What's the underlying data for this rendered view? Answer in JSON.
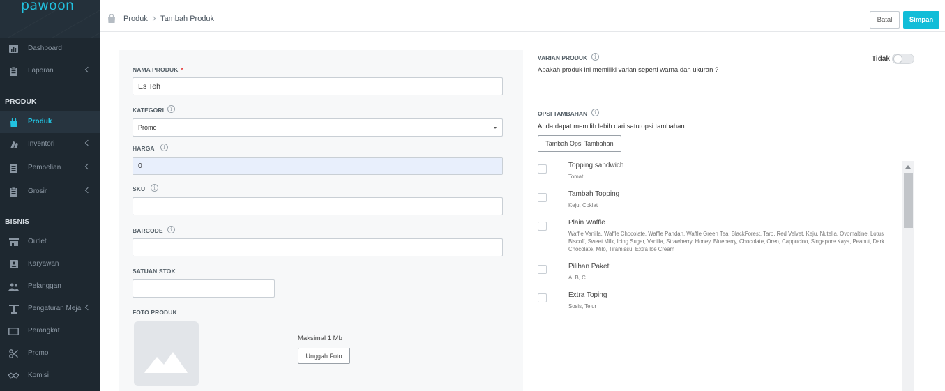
{
  "app": {
    "brand": "pawoon"
  },
  "sidebar": {
    "items_top": [
      {
        "label": "Dashboard",
        "icon": "bar-chart-icon",
        "chevron": false
      },
      {
        "label": "Laporan",
        "icon": "clipboard-icon",
        "chevron": true
      }
    ],
    "section_produk": "PRODUK",
    "items_produk": [
      {
        "label": "Produk",
        "icon": "shopping-bag-icon",
        "chevron": false,
        "active": true
      },
      {
        "label": "Inventori",
        "icon": "boxes-icon",
        "chevron": true
      },
      {
        "label": "Pembelian",
        "icon": "document-icon",
        "chevron": true
      },
      {
        "label": "Grosir",
        "icon": "clipboard-icon",
        "chevron": true
      }
    ],
    "section_bisnis": "BISNIS",
    "items_bisnis": [
      {
        "label": "Outlet",
        "icon": "store-icon",
        "chevron": false
      },
      {
        "label": "Karyawan",
        "icon": "id-card-icon",
        "chevron": false
      },
      {
        "label": "Pelanggan",
        "icon": "users-icon",
        "chevron": false
      },
      {
        "label": "Pengaturan Meja",
        "icon": "table-icon",
        "chevron": true
      },
      {
        "label": "Perangkat",
        "icon": "tablet-icon",
        "chevron": false
      },
      {
        "label": "Promo",
        "icon": "scissors-icon",
        "chevron": false
      },
      {
        "label": "Komisi",
        "icon": "handshake-icon",
        "chevron": false
      }
    ]
  },
  "header": {
    "breadcrumb": [
      "Produk",
      "Tambah Produk"
    ],
    "cancel_label": "Batal",
    "save_label": "Simpan"
  },
  "form": {
    "nama_label": "NAMA PRODUK",
    "required_mark": "*",
    "nama_value": "Es Teh",
    "kategori_label": "KATEGORI",
    "kategori_value": "Promo",
    "harga_label": "HARGA",
    "harga_value": "0",
    "sku_label": "SKU",
    "sku_value": "",
    "barcode_label": "BARCODE",
    "barcode_value": "",
    "satuan_label": "SATUAN STOK",
    "satuan_value": "",
    "foto_label": "FOTO PRODUK",
    "foto_hint": "Maksimal 1 Mb",
    "upload_label": "Unggah Foto"
  },
  "varian": {
    "label": "VARIAN PRODUK",
    "desc": "Apakah produk ini memiliki varian seperti warna dan ukuran ?",
    "toggle_label": "Tidak",
    "enabled": false
  },
  "opsi": {
    "label": "OPSI TAMBAHAN",
    "desc": "Anda dapat memilih lebih dari satu opsi tambahan",
    "add_label": "Tambah Opsi Tambahan",
    "items": [
      {
        "name": "Topping sandwich",
        "sub": "Tomat",
        "checked": false
      },
      {
        "name": "Tambah Topping",
        "sub": "Keju, Coklat",
        "checked": false
      },
      {
        "name": "Plain Waffle",
        "sub": "Waffle Vanilla, Waffle Chocolate, Waffle Pandan, Waffle Green Tea, BlackForest, Taro, Red Velvet, Keju, Nutella, Ovomaltine, Lotus Biscoff, Sweet Milk, Icing Sugar, Vanilla, Strawberry, Honey, Blueberry, Chocolate, Oreo, Cappucino, Singapore Kaya, Peanut, Dark Chocolate, Milo, Tiramissu, Extra Ice Cream",
        "checked": false
      },
      {
        "name": "Pilihan Paket",
        "sub": "A, B, C",
        "checked": false
      },
      {
        "name": "Extra Toping",
        "sub": "Sosis, Telur",
        "checked": false
      }
    ]
  }
}
